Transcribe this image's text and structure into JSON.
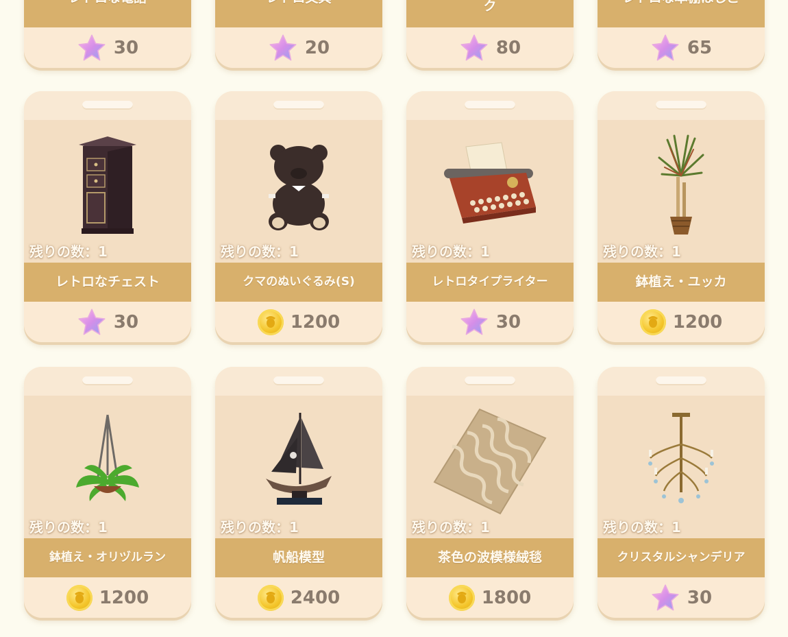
{
  "top_row": [
    {
      "name": "レトロな電話",
      "currency": "star",
      "price": "30"
    },
    {
      "name": "レトロ文具",
      "currency": "star",
      "price": "20"
    },
    {
      "name": "ク",
      "currency": "star",
      "price": "80"
    },
    {
      "name": "レトロな本棚はしご",
      "currency": "star",
      "price": "65"
    }
  ],
  "rows": [
    [
      {
        "remain": "残りの数：1",
        "name": "レトロなチェスト",
        "currency": "star",
        "price": "30",
        "icon": "chest-icon"
      },
      {
        "remain": "残りの数：1",
        "name": "クマのぬいぐるみ(S)",
        "currency": "coin",
        "price": "1200",
        "icon": "teddy-bear-icon"
      },
      {
        "remain": "残りの数：1",
        "name": "レトロタイプライター",
        "currency": "star",
        "price": "30",
        "icon": "typewriter-icon"
      },
      {
        "remain": "残りの数：1",
        "name": "鉢植え・ユッカ",
        "currency": "coin",
        "price": "1200",
        "icon": "yucca-plant-icon"
      }
    ],
    [
      {
        "remain": "残りの数：1",
        "name": "鉢植え・オリヅルラン",
        "currency": "coin",
        "price": "1200",
        "icon": "hanging-plant-icon"
      },
      {
        "remain": "残りの数：1",
        "name": "帆船模型",
        "currency": "coin",
        "price": "2400",
        "icon": "sailboat-model-icon"
      },
      {
        "remain": "残りの数：1",
        "name": "茶色の波模様絨毯",
        "currency": "coin",
        "price": "1800",
        "icon": "wave-rug-icon"
      },
      {
        "remain": "残りの数：1",
        "name": "クリスタルシャンデリア",
        "currency": "star",
        "price": "30",
        "icon": "chandelier-icon"
      }
    ]
  ],
  "colors": {
    "band": "#d8b06c",
    "card": "#f7e5cd",
    "price_text": "#8a7b6d",
    "background": "#fdfbef"
  }
}
